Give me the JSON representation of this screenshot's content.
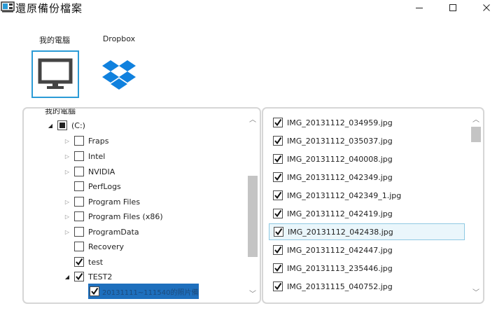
{
  "window": {
    "title": "還原備份檔案",
    "minimize_glyph": "—",
    "maximize_glyph": "☐",
    "close_glyph": "✕"
  },
  "sources": [
    {
      "label": "我的電腦",
      "icon": "monitor-icon",
      "selected": true
    },
    {
      "label": "Dropbox",
      "icon": "dropbox-icon",
      "selected": false
    }
  ],
  "tree": {
    "root_label": "我的電腦",
    "drive": {
      "label": "(C:)",
      "state": "partial",
      "expanded": true
    },
    "items": [
      {
        "label": "Fraps",
        "state": "unchecked",
        "expandable": true
      },
      {
        "label": "Intel",
        "state": "unchecked",
        "expandable": true
      },
      {
        "label": "NVIDIA",
        "state": "unchecked",
        "expandable": true
      },
      {
        "label": "PerfLogs",
        "state": "unchecked",
        "expandable": false
      },
      {
        "label": "Program Files",
        "state": "unchecked",
        "expandable": true
      },
      {
        "label": "Program Files (x86)",
        "state": "unchecked",
        "expandable": true
      },
      {
        "label": "ProgramData",
        "state": "unchecked",
        "expandable": true
      },
      {
        "label": "Recovery",
        "state": "unchecked",
        "expandable": false
      },
      {
        "label": "test",
        "state": "checked",
        "expandable": false
      },
      {
        "label": "TEST2",
        "state": "checked",
        "expandable": true,
        "expanded": true
      }
    ],
    "child": {
      "label": "20131111~111540的照片備份",
      "state": "checked",
      "selected": true
    }
  },
  "files": [
    {
      "name": "IMG_20131112_034959.jpg",
      "checked": true
    },
    {
      "name": "IMG_20131112_035037.jpg",
      "checked": true
    },
    {
      "name": "IMG_20131112_040008.jpg",
      "checked": true
    },
    {
      "name": "IMG_20131112_042349.jpg",
      "checked": true
    },
    {
      "name": "IMG_20131112_042349_1.jpg",
      "checked": true
    },
    {
      "name": "IMG_20131112_042419.jpg",
      "checked": true
    },
    {
      "name": "IMG_20131112_042438.jpg",
      "checked": true,
      "active": true
    },
    {
      "name": "IMG_20131112_042447.jpg",
      "checked": true
    },
    {
      "name": "IMG_20131113_235446.jpg",
      "checked": true
    },
    {
      "name": "IMG_20131115_040752.jpg",
      "checked": true
    }
  ],
  "colors": {
    "accent": "#2b9bd6",
    "dropbox": "#1081de",
    "selection": "#1e6fbd",
    "active_row": "#eaf6fb"
  }
}
